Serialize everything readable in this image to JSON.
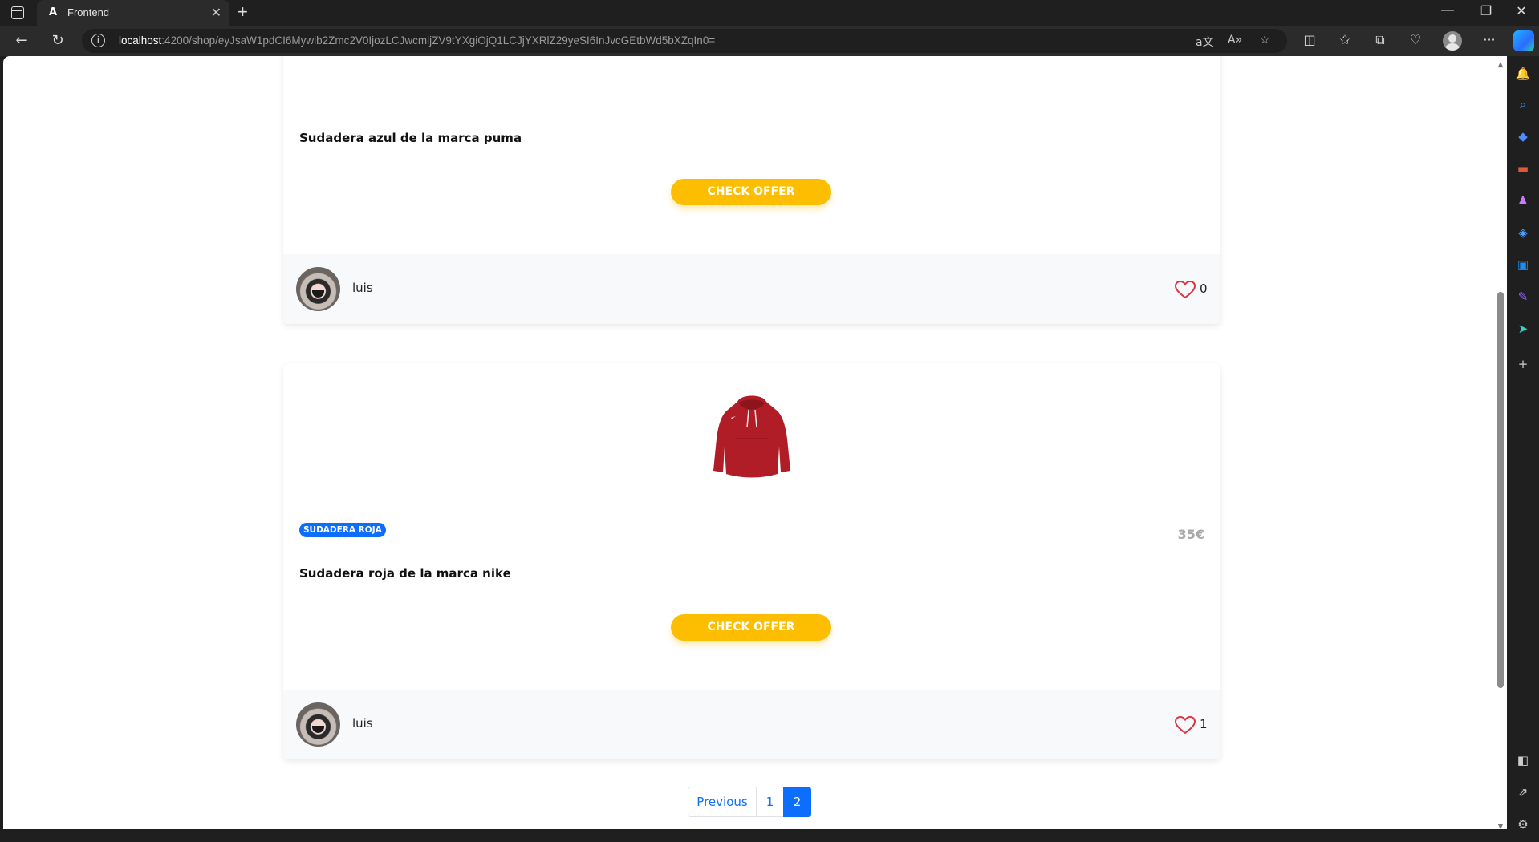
{
  "browser": {
    "tab_title": "Frontend",
    "tab_favicon": "A",
    "url_host": "localhost",
    "url_rest": ":4200/shop/eyJsaW1pdCI6Mywib2Zmc2V0IjozLCJwcmljZV9tYXgiOjQ1LCJjYXRlZ29yeSI6InJvcGEtbWd5bXZqIn0=",
    "icons": {
      "back": "back-arrow-icon",
      "refresh": "refresh-icon",
      "site_info": "info-icon",
      "translate": "translate-icon",
      "read_aloud": "read-aloud-icon",
      "favorite": "star-icon",
      "split": "split-screen-icon",
      "favorites_bar": "favorites-icon",
      "collections": "collections-icon",
      "health": "browser-essentials-icon",
      "more": "more-icon"
    }
  },
  "page": {
    "cards": [
      {
        "description": "Sudadera azul de la marca puma",
        "button_label": "CHECK OFFER",
        "author": "luis",
        "likes": "0"
      },
      {
        "category": "SUDADERA ROJA",
        "price": "35€",
        "description": "Sudadera roja de la marca nike",
        "button_label": "CHECK OFFER",
        "author": "luis",
        "likes": "1"
      }
    ],
    "pagination": {
      "previous": "Previous",
      "pages": [
        "1",
        "2"
      ],
      "active_page": "2"
    }
  },
  "colors": {
    "offer_button": "#fdbd00",
    "primary": "#0d6efd",
    "price": "#a9a9a9",
    "heart": "#dc3545",
    "hoodie": "#b11d26"
  }
}
